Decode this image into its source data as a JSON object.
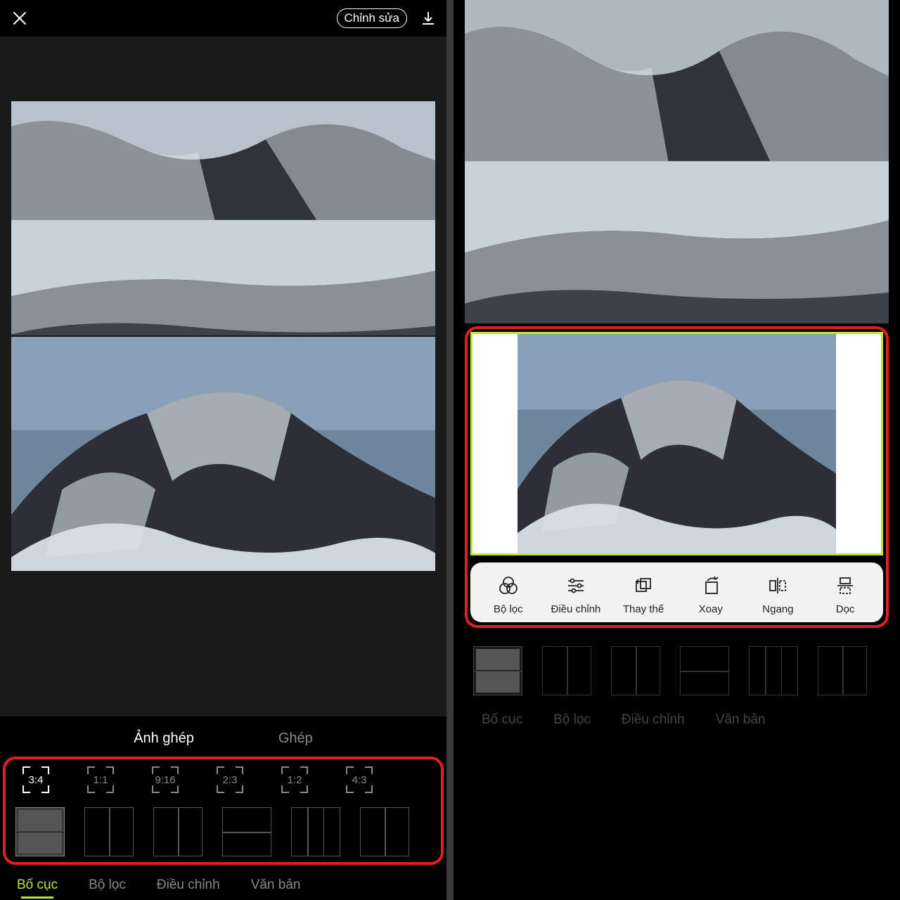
{
  "topbar": {
    "edit_label": "Chỉnh sửa"
  },
  "mode_tabs": {
    "collage": "Ảnh ghép",
    "stitch": "Ghép"
  },
  "aspect_ratios": [
    "3:4",
    "1:1",
    "9:16",
    "2:3",
    "1:2",
    "4:3"
  ],
  "bottom_tabs": {
    "layout": "Bố cục",
    "filter": "Bộ lọc",
    "adjust": "Điều chỉnh",
    "text": "Văn bản"
  },
  "right_tools": {
    "filter": "Bộ lọc",
    "adjust": "Điều chỉnh",
    "replace": "Thay thế",
    "rotate": "Xoay",
    "horizontal": "Ngang",
    "vertical": "Dọc"
  },
  "colors": {
    "accent": "#b8e830",
    "highlight_box": "#e02020"
  }
}
